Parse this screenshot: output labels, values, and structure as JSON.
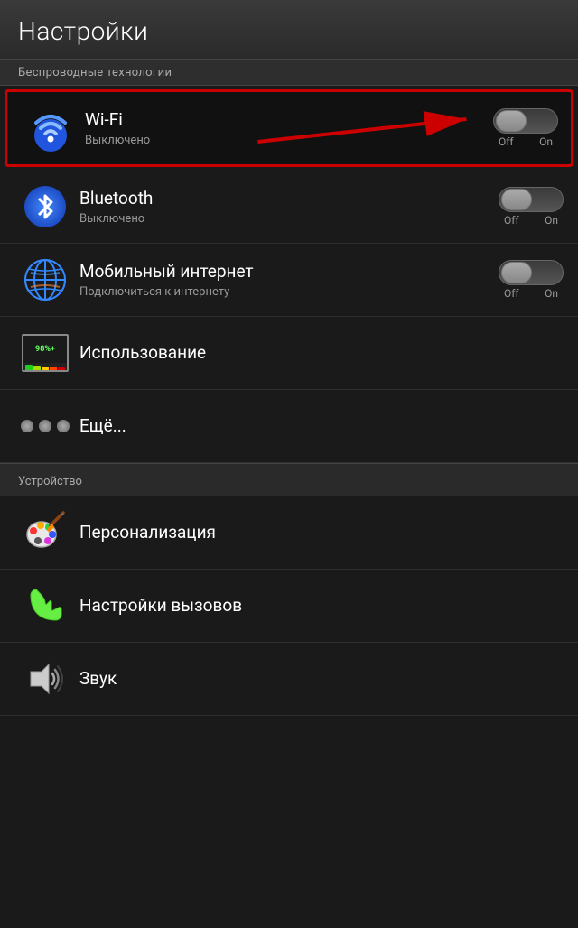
{
  "header": {
    "title": "Настройки"
  },
  "wireless_section": {
    "label": "Беспроводные технологии"
  },
  "items": [
    {
      "id": "wifi",
      "title": "Wi-Fi",
      "subtitle": "Выключено",
      "toggle_off": "Off",
      "toggle_on": "On",
      "highlighted": true
    },
    {
      "id": "bluetooth",
      "title": "Bluetooth",
      "subtitle": "Выключено",
      "toggle_off": "Off",
      "toggle_on": "On",
      "highlighted": false
    },
    {
      "id": "mobile_internet",
      "title": "Мобильный интернет",
      "subtitle": "Подключиться к интернету",
      "toggle_off": "Off",
      "toggle_on": "On",
      "highlighted": false
    },
    {
      "id": "usage",
      "title": "Использование",
      "subtitle": "",
      "highlighted": false
    },
    {
      "id": "more",
      "title": "Ещё...",
      "subtitle": "",
      "highlighted": false
    }
  ],
  "device_section": {
    "label": "Устройство"
  },
  "device_items": [
    {
      "id": "personalization",
      "title": "Персонализация"
    },
    {
      "id": "calls",
      "title": "Настройки вызовов"
    },
    {
      "id": "sound",
      "title": "Звук"
    }
  ],
  "colors": {
    "highlight_border": "#cc0000",
    "toggle_bg": "#444",
    "accent_blue": "#2255cc"
  }
}
